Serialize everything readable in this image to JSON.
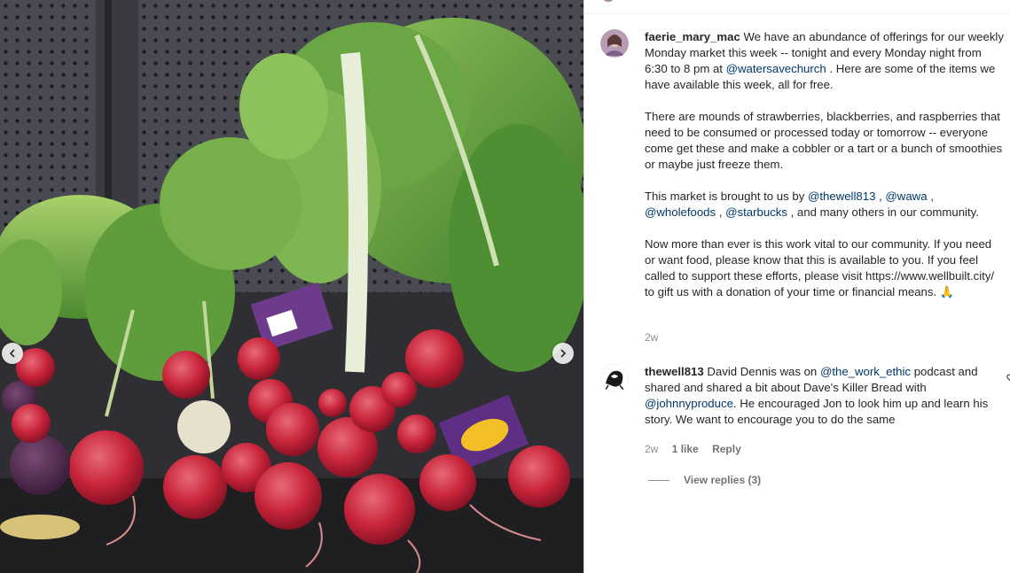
{
  "post": {
    "photo_alt": "",
    "carousel": {
      "prev_icon": "chevron-left-icon",
      "next_icon": "chevron-right-icon"
    }
  },
  "caption": {
    "username": "faerie_mary_mac",
    "p1_text1": "We have an abundance of offerings for our weekly Monday market this week -- tonight and every Monday night from 6:30 to 8 pm at ",
    "p1_mention": "@watersavechurch",
    "p1_text2": " . Here are some of the items we have available this week, all for free.",
    "p2": "There are mounds of strawberries, blackberries, and raspberries that need to be consumed or processed today or tomorrow -- everyone come get these and make a cobbler or a tart or a bunch of smoothies or maybe just freeze them.",
    "p3_text1": "This market is brought to us by ",
    "p3_m1": "@thewell813",
    "p3_sep1": " , ",
    "p3_m2": "@wawa",
    "p3_sep2": " , ",
    "p3_m3": "@wholefoods",
    "p3_sep3": " , ",
    "p3_m4": "@starbucks",
    "p3_text2": " , and many others in our community.",
    "p4": "Now more than ever is this work vital to our community. If you need or want food, please know that this is available to you. If you feel called to support these efforts, please visit https://www.wellbuilt.city/ to gift us with a donation of your time or financial means.",
    "p4_emoji": "🙏",
    "time": "2w"
  },
  "comment": {
    "username": "thewell813",
    "text1": " David Dennis was on ",
    "mention1": "@the_work_ethic",
    "text2": " podcast and shared and shared a bit about Dave's Killer Bread with ",
    "mention2": "@johnnyproduce",
    "text3": ". He encouraged Jon to look him up and learn his story. We want to encourage you to do the same",
    "time": "2w",
    "likes": "1 like",
    "reply": "Reply",
    "view_replies": "View replies (3)"
  },
  "colors": {
    "mention": "#00376b",
    "meta": "#8e8e8e",
    "text": "#262626"
  }
}
